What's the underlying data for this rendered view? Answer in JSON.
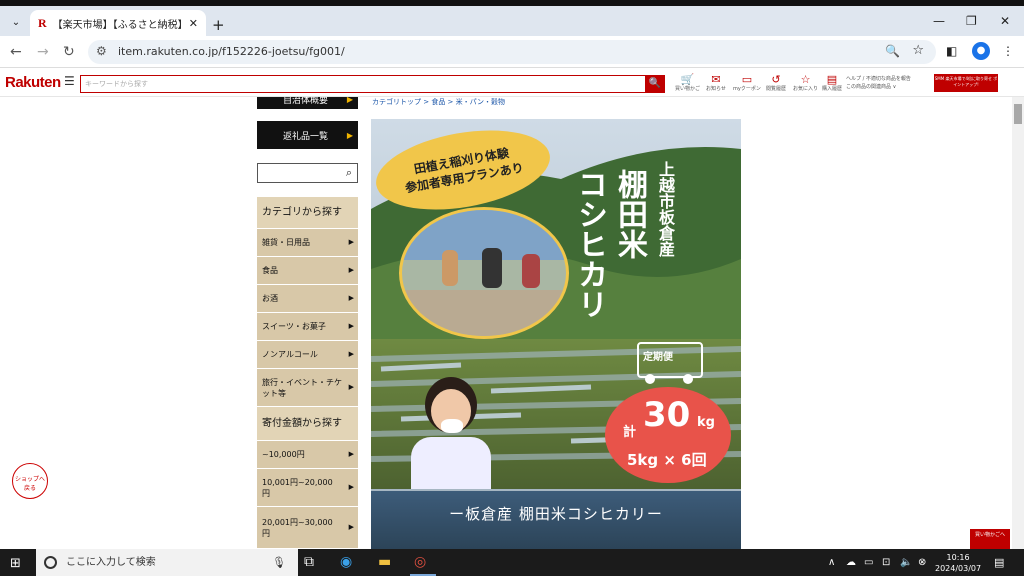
{
  "browser": {
    "tab_title": "【楽天市場】【ふるさと納税】【先行",
    "tab_favicon": "R",
    "url": "item.rakuten.co.jp/f152226-joetsu/fg001/"
  },
  "rakuten_header": {
    "logo": "Rakuten",
    "search_placeholder": "キーワードから探す",
    "icons": [
      {
        "name": "cart",
        "label": "買い物かご"
      },
      {
        "name": "message",
        "label": "お知らせ"
      },
      {
        "name": "coupon",
        "label": "myクーポン"
      },
      {
        "name": "history",
        "label": "閲覧履歴"
      },
      {
        "name": "favorite",
        "label": "お気に入り"
      },
      {
        "name": "purchase-history",
        "label": "購入履歴"
      }
    ],
    "help_line1": "ヘルプ / 不適切な商品を報告",
    "help_line2": "この商品の関連商品 ∨",
    "banner_text": "SMM 楽天市場で4倍に取り寄せ ポイントアップ!"
  },
  "breadcrumb": "カテゴリトップ > 食品 > 米・パン・穀物",
  "sidebar": {
    "top_button": "自治体概要",
    "return_button": "返礼品一覧",
    "category_head": "カテゴリから探す",
    "categories": [
      "雑貨・日用品",
      "食品",
      "お酒",
      "スイーツ・お菓子",
      "ノンアルコール",
      "旅行・イベント・チケット等"
    ],
    "amount_head": "寄付金額から探す",
    "amounts": [
      "~10,000円",
      "10,001円~20,000円",
      "20,001円~30,000円"
    ]
  },
  "hero": {
    "bubble_line1": "田植え稲刈り体験",
    "bubble_line2": "参加者専用プランあり",
    "origin": "上越市板倉産",
    "rice_name_1": "棚田米",
    "rice_name_2": "コシヒカリ",
    "subscription": "定期便",
    "total_prefix": "計",
    "total_amount": "30",
    "total_unit": "kg",
    "per_delivery": "5kg × 6回",
    "bottom_text": "ー板倉産 棚田米コシヒカリー"
  },
  "shop_button": "ショップへ 戻る",
  "cart_button": "買い物かごへ",
  "taskbar": {
    "search_placeholder": "ここに入力して検索",
    "time": "10:16",
    "date": "2024/03/07"
  },
  "colors": {
    "rakuten_red": "#bf0000",
    "sidebar_beige": "#d8c8a8"
  }
}
